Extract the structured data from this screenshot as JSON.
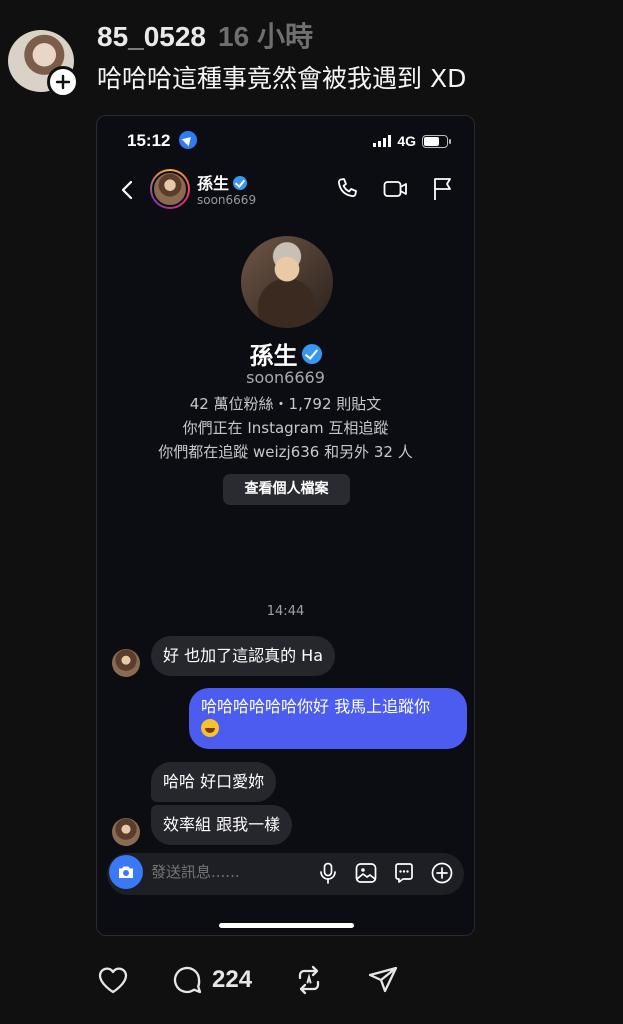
{
  "post": {
    "username": "85_0528",
    "time_ago": "16 小時",
    "text": "哈哈哈這種事竟然會被我遇到 XD"
  },
  "screenshot": {
    "status_bar": {
      "time": "15:12",
      "network": "4G",
      "battery_level": 0.7
    },
    "chat_header": {
      "name": "孫生",
      "handle": "soon6669",
      "verified": true
    },
    "profile": {
      "name": "孫生",
      "handle": "soon6669",
      "stats": "42 萬位粉絲・1,792 則貼文",
      "mutual": "你們正在 Instagram 互相追蹤",
      "followed_by": "你們都在追蹤 weizj636 和另外 32 人",
      "view_profile_button": "查看個人檔案"
    },
    "messages": {
      "time_divider": "14:44",
      "incoming_1": "好 也加了這認真的 Ha",
      "outgoing_1": "哈哈哈哈哈哈你好 我馬上追蹤你",
      "incoming_2": "哈哈 好口愛妳",
      "incoming_3": "效率組 跟我一樣"
    },
    "composer": {
      "placeholder": "發送訊息......"
    }
  },
  "actions": {
    "reply_count": "224"
  },
  "icons": [
    "plus-icon",
    "location-arrow-icon",
    "signal-icon",
    "battery-icon",
    "back-chevron-icon",
    "phone-icon",
    "video-icon",
    "flag-icon",
    "verified-icon",
    "camera-icon",
    "microphone-icon",
    "image-icon",
    "sticker-icon",
    "add-icon",
    "heart-icon",
    "comment-icon",
    "repost-icon",
    "share-icon"
  ],
  "colors": {
    "background": "#101010",
    "outgoing_bubble": "#4c5cf0",
    "camera_button": "#3a78f5",
    "verified": "#3897f0"
  }
}
